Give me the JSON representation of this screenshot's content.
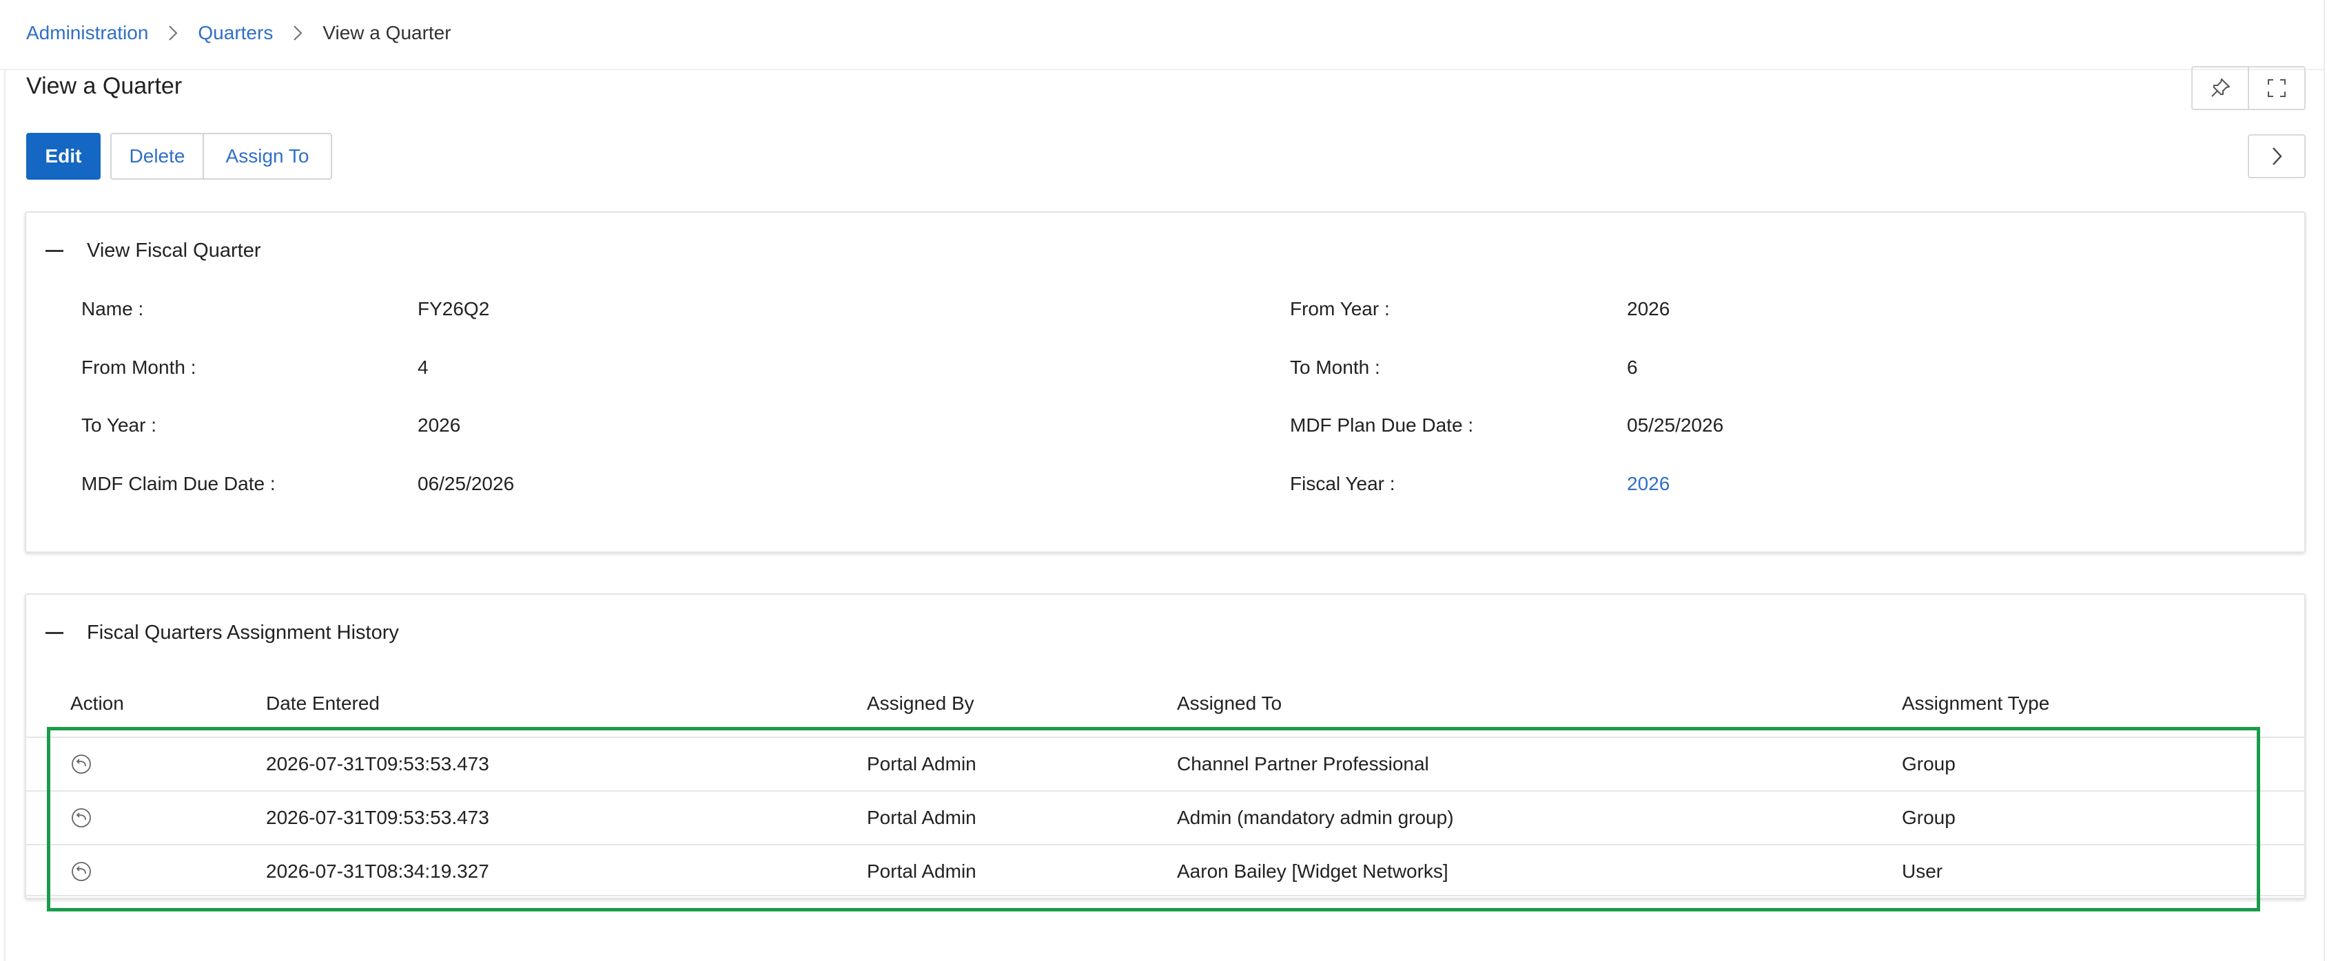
{
  "breadcrumb": {
    "items": [
      "Administration",
      "Quarters"
    ],
    "current": "View a Quarter"
  },
  "page": {
    "title": "View a Quarter"
  },
  "toolbar": {
    "edit_label": "Edit",
    "delete_label": "Delete",
    "assign_label": "Assign To"
  },
  "icons": {
    "pin": "pin-icon",
    "fullscreen": "fullscreen-icon",
    "next": "chevron-right-icon",
    "collapse": "minus-icon",
    "row_action": "undo-icon"
  },
  "colors": {
    "accent": "#1467c2",
    "link": "#2f6fc9",
    "highlight": "#1a9b4b"
  },
  "details_panel": {
    "title": "View Fiscal Quarter",
    "fields": [
      {
        "label": "Name :",
        "value": "FY26Q2",
        "is_link": false
      },
      {
        "label": "From Month :",
        "value": "4",
        "is_link": false
      },
      {
        "label": "To Year :",
        "value": "2026",
        "is_link": false
      },
      {
        "label": "MDF Claim Due Date :",
        "value": "06/25/2026",
        "is_link": false
      },
      {
        "label": "From Year :",
        "value": "2026",
        "is_link": false
      },
      {
        "label": "To Month :",
        "value": "6",
        "is_link": false
      },
      {
        "label": "MDF Plan Due Date :",
        "value": "05/25/2026",
        "is_link": false
      },
      {
        "label": "Fiscal Year :",
        "value": "2026",
        "is_link": true
      }
    ]
  },
  "history_panel": {
    "title": "Fiscal Quarters Assignment History",
    "columns": [
      "Action",
      "Date Entered",
      "Assigned By",
      "Assigned To",
      "Assignment Type"
    ],
    "rows": [
      {
        "date_entered": "2026-07-31T09:53:53.473",
        "assigned_by": "Portal Admin",
        "assigned_to": "Channel Partner Professional",
        "assignment_type": "Group"
      },
      {
        "date_entered": "2026-07-31T09:53:53.473",
        "assigned_by": "Portal Admin",
        "assigned_to": "Admin (mandatory admin group)",
        "assignment_type": "Group"
      },
      {
        "date_entered": "2026-07-31T08:34:19.327",
        "assigned_by": "Portal Admin",
        "assigned_to": "Aaron Bailey [Widget Networks]",
        "assignment_type": "User"
      }
    ]
  }
}
